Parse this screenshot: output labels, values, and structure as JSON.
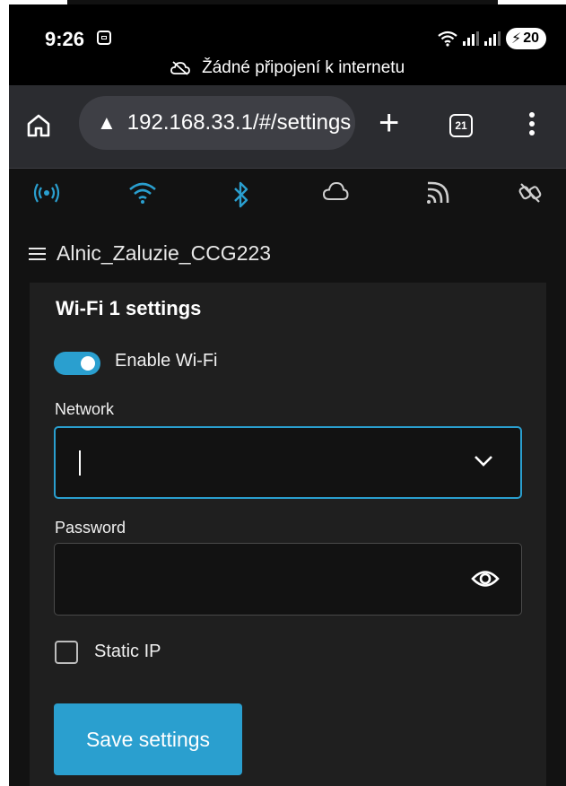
{
  "status_bar": {
    "time": "9:26",
    "battery": "20",
    "offline_message": "Žádné připojení k internetu"
  },
  "browser": {
    "url": "192.168.33.1/#/settings",
    "tab_count": "21"
  },
  "app": {
    "title": "Alnic_Zaluzie_CCG223",
    "nav_icons": [
      "wifi-ap-icon",
      "wifi-icon",
      "bluetooth-icon",
      "cloud-icon",
      "mqtt-icon",
      "link-off-icon"
    ]
  },
  "card": {
    "title": "Wi-Fi 1 settings",
    "enable_label": "Enable Wi-Fi",
    "enable_on": true,
    "network_label": "Network",
    "network_value": "",
    "password_label": "Password",
    "password_value": "",
    "static_ip_label": "Static IP",
    "static_ip_checked": false,
    "save_label": "Save settings"
  },
  "colors": {
    "accent": "#2a9fcf",
    "background": "#121212",
    "card": "#1f1f1f"
  }
}
